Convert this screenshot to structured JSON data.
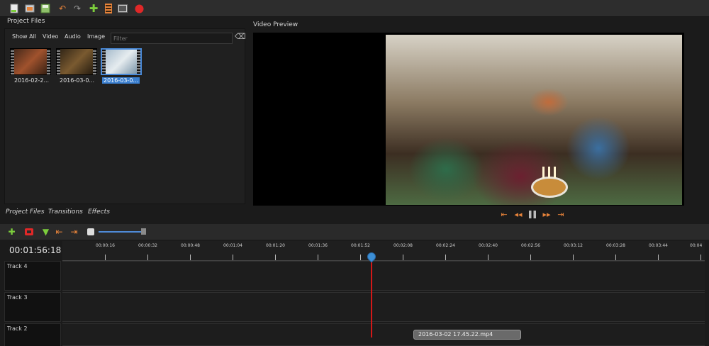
{
  "toolbar": {
    "icons": [
      "new-project-icon",
      "open-project-icon",
      "save-project-icon",
      "undo-icon",
      "redo-icon",
      "import-files-icon",
      "export-film-icon",
      "fullscreen-icon",
      "record-icon"
    ],
    "colors": {
      "accent": "#e6833a",
      "green": "#7ccd3c",
      "record": "#e02828"
    }
  },
  "project_files": {
    "title": "Project Files",
    "filters": [
      "Show All",
      "Video",
      "Audio",
      "Image"
    ],
    "filter_placeholder": "Filter",
    "files": [
      {
        "label": "2016-02-2..."
      },
      {
        "label": "2016-03-0..."
      },
      {
        "label": "2016-03-0..."
      }
    ]
  },
  "video_preview": {
    "title": "Video Preview",
    "controls": [
      "jump-start-icon",
      "rewind-icon",
      "pause-icon",
      "fast-forward-icon",
      "jump-end-icon"
    ]
  },
  "tabs": [
    "Project Files",
    "Transitions",
    "Effects"
  ],
  "timeline": {
    "current_time": "00:01:56:18",
    "ruler_labels": [
      "00:00:16",
      "00:00:32",
      "00:00:48",
      "00:01:04",
      "00:01:20",
      "00:01:36",
      "00:01:52",
      "00:02:08",
      "00:02:24",
      "00:02:40",
      "00:02:56",
      "00:03:12",
      "00:03:28",
      "00:03:44",
      "00:04"
    ],
    "tracks": [
      "Track 4",
      "Track 3",
      "Track 2"
    ],
    "clip_label": "2016-03-02 17.45.22.mp4"
  }
}
